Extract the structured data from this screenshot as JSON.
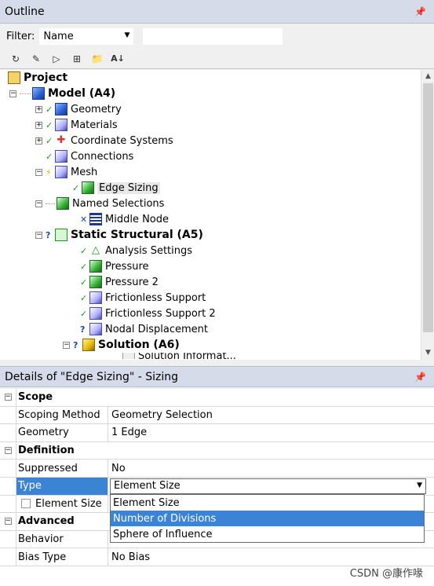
{
  "outline": {
    "title": "Outline",
    "pin": "⯐",
    "filter_label": "Filter:",
    "filter_value": "Name",
    "filter_text": ""
  },
  "toolbar": {
    "buttons": [
      "refresh-icon",
      "eraser-icon",
      "tree-filter-icon",
      "expand-icon",
      "folder-icon",
      "sort-az-icon"
    ]
  },
  "tree": {
    "project": "Project",
    "model": "Model (A4)",
    "geometry": "Geometry",
    "materials": "Materials",
    "coordinate_systems": "Coordinate Systems",
    "connections": "Connections",
    "mesh": "Mesh",
    "edge_sizing": "Edge Sizing",
    "named_selections": "Named Selections",
    "middle_node": "Middle Node",
    "static_structural": "Static Structural (A5)",
    "analysis_settings": "Analysis Settings",
    "pressure": "Pressure",
    "pressure2": "Pressure 2",
    "frictionless1": "Frictionless Support",
    "frictionless2": "Frictionless Support 2",
    "nodal_displacement": "Nodal Displacement",
    "solution": "Solution (A6)",
    "solution_info": "Solution Informat..."
  },
  "details": {
    "title": "Details of \"Edge Sizing\" - Sizing",
    "scope": "Scope",
    "scoping_method_label": "Scoping Method",
    "scoping_method_value": "Geometry Selection",
    "geometry_label": "Geometry",
    "geometry_value": "1 Edge",
    "definition": "Definition",
    "suppressed_label": "Suppressed",
    "suppressed_value": "No",
    "type_label": "Type",
    "type_value": "Element Size",
    "element_size_label": "Element Size",
    "advanced": "Advanced",
    "behavior_label": "Behavior",
    "bias_type_label": "Bias Type",
    "bias_type_value": "No Bias"
  },
  "dropdown_options": [
    "Element Size",
    "Number of Divisions",
    "Sphere of Influence"
  ],
  "dropdown_selected_index": 1,
  "watermark": "CSDN @康作喙"
}
